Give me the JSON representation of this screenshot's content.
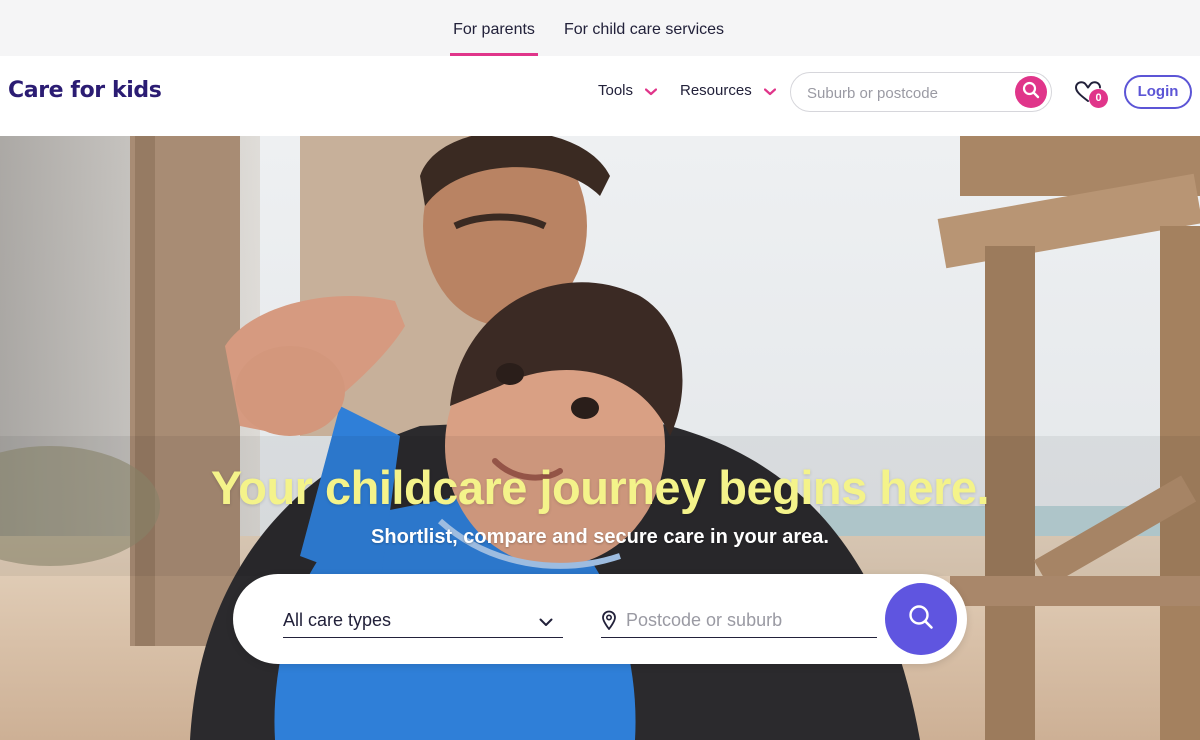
{
  "audience_tabs": [
    {
      "label": "For parents",
      "active": true
    },
    {
      "label": "For child care services",
      "active": false
    }
  ],
  "header": {
    "logo": "Care for kids",
    "nav": [
      {
        "label": "Tools",
        "icon": "chevron-down-icon"
      },
      {
        "label": "Resources",
        "icon": "chevron-down-icon"
      }
    ],
    "search_placeholder": "Suburb or postcode",
    "favourites_count": "0",
    "login_label": "Login"
  },
  "hero": {
    "headline": "Your childcare journey begins here.",
    "subheadline": "Shortlist, compare and secure care in your area.",
    "care_type_selected": "All care types",
    "postcode_placeholder": "Postcode or suburb"
  },
  "colors": {
    "brand_pink": "#e0358a",
    "brand_purple": "#5f55e0",
    "logo_navy": "#2b1c73",
    "headline_yellow": "#f4f38a"
  }
}
